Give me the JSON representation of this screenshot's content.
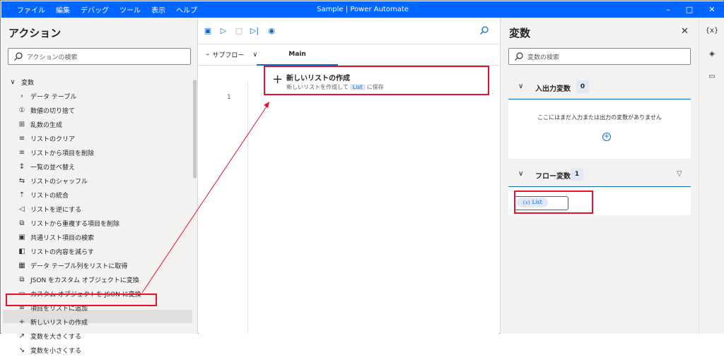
{
  "menu": [
    "ファイル",
    "編集",
    "デバッグ",
    "ツール",
    "表示",
    "ヘルプ"
  ],
  "app_title": "Sample | Power Automate",
  "window_buttons": [
    "–",
    "□",
    "✕"
  ],
  "actions_panel": {
    "title": "アクション",
    "search_placeholder": "アクションの検索",
    "tree": [
      {
        "label": "変数",
        "icon": "∨"
      },
      {
        "label": "データ テーブル",
        "icon": "›"
      },
      {
        "label": "数値の切り捨て",
        "icon": "①"
      },
      {
        "label": "乱数の生成",
        "icon": "⊞"
      },
      {
        "label": "リストのクリア",
        "icon": "≡"
      },
      {
        "label": "リストから項目を削除",
        "icon": "≡"
      },
      {
        "label": "一覧の並べ替え",
        "icon": "↕"
      },
      {
        "label": "リストのシャッフル",
        "icon": "⇆"
      },
      {
        "label": "リストの統合",
        "icon": "⇡"
      },
      {
        "label": "リストを逆にする",
        "icon": "◁"
      },
      {
        "label": "リストから重複する項目を削除",
        "icon": "⧉"
      },
      {
        "label": "共通リスト項目の検索",
        "icon": "▣"
      },
      {
        "label": "リストの内容を減らす",
        "icon": "◧"
      },
      {
        "label": "データ テーブル列をリストに取得",
        "icon": "▦"
      },
      {
        "label": "JSON をカスタム オブジェクトに変換",
        "icon": "⧉"
      },
      {
        "label": "カスタム オブジェクトを JSON に変換",
        "icon": "▭"
      },
      {
        "label": "項目をリストに追加",
        "icon": "≡"
      },
      {
        "label": "新しいリストの作成",
        "icon": "+"
      },
      {
        "label": "変数を大きくする",
        "icon": "↗"
      },
      {
        "label": "変数を小さくする",
        "icon": "↘"
      }
    ]
  },
  "editor": {
    "subflow_label": "サブフロー",
    "main_tab": "Main",
    "line_number": "1",
    "step": {
      "title": "新しいリストの作成",
      "desc_before": "新しいリストを作成して",
      "var": "List",
      "desc_after": "に保存"
    }
  },
  "variables_panel": {
    "title": "変数",
    "search_placeholder": "変数の検索",
    "io_section": {
      "label": "入出力変数",
      "count": "0",
      "empty_message": "ここにはまだ入力または出力の変数がありません"
    },
    "flow_section": {
      "label": "フロー変数",
      "count": "1",
      "var_prefix": "{x}",
      "var_name": "List"
    }
  },
  "rail": [
    "{x}",
    "◈",
    "▭"
  ],
  "colors": {
    "titlebar": "#0066ff",
    "accent": "#0f6cbd",
    "highlight": "#e8102b"
  }
}
